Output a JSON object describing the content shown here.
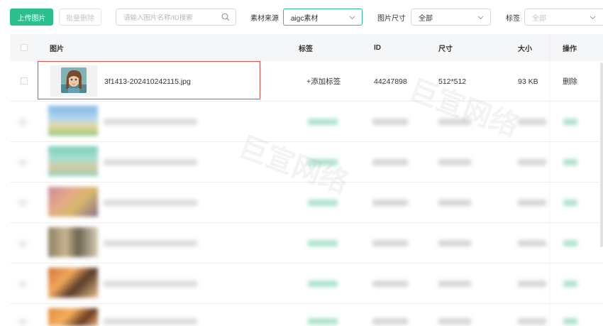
{
  "toolbar": {
    "upload_label": "上传图片",
    "batch_delete_label": "批量删除",
    "search_placeholder": "请输入图片名称/ID搜索",
    "source_label": "素材来源",
    "source_value": "aigc素材",
    "size_label": "图片尺寸",
    "size_value": "全部",
    "tag_label": "标签",
    "tag_value": "全部"
  },
  "table": {
    "columns": {
      "image": "图片",
      "tag": "标签",
      "id": "ID",
      "size": "尺寸",
      "filesize": "大小",
      "action": "操作"
    },
    "rows": [
      {
        "filename": "3f1413-202410242115.jpg",
        "tag_action": "+添加标签",
        "id": "44247898",
        "dimensions": "512*512",
        "filesize": "93 KB",
        "action": "删除"
      }
    ]
  },
  "watermark": "巨宣网络",
  "colors": {
    "accent": "#2bbf8e",
    "highlight": "#e0524b",
    "header_bg": "#f5f6f7"
  }
}
